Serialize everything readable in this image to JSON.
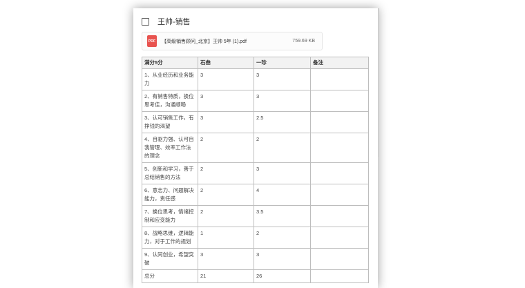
{
  "task": {
    "title": "王帅-销售"
  },
  "attachment": {
    "icon": "pdf-icon",
    "icon_text": "PDF",
    "name": "【高级销售顾问_北京】王帅 5年 (1).pdf",
    "size": "759.69 KB"
  },
  "table": {
    "headers": [
      "满分5分",
      "石叁",
      "一珍",
      "备注"
    ],
    "rows": [
      {
        "criterion": "1、从业经历和业务能力",
        "a": "3",
        "b": "3",
        "note": ""
      },
      {
        "criterion": "2、有销售特质，换位思考佳，沟通顺畅",
        "a": "3",
        "b": "3",
        "note": ""
      },
      {
        "criterion": "3、认可销售工作，有挣钱的渴望",
        "a": "3",
        "b": "2.5",
        "note": ""
      },
      {
        "criterion": "4、自驱力强、认可自我管理、效率工作法的理念",
        "a": "2",
        "b": "2",
        "note": ""
      },
      {
        "criterion": "5、创新和学习，善于总结销售的方法",
        "a": "2",
        "b": "3",
        "note": ""
      },
      {
        "criterion": "6、意志力、问题解决能力，责任感",
        "a": "2",
        "b": "4",
        "note": ""
      },
      {
        "criterion": "7、换位思考，情绪控制和应变能力",
        "a": "2",
        "b": "3.5",
        "note": ""
      },
      {
        "criterion": "8、战略思维，逻辑能力，对于工作的规划",
        "a": "1",
        "b": "2",
        "note": ""
      },
      {
        "criterion": "9、认同创业，希望突破",
        "a": "3",
        "b": "3",
        "note": ""
      }
    ],
    "total": {
      "label": "总分",
      "a": "21",
      "b": "26",
      "note": ""
    }
  }
}
